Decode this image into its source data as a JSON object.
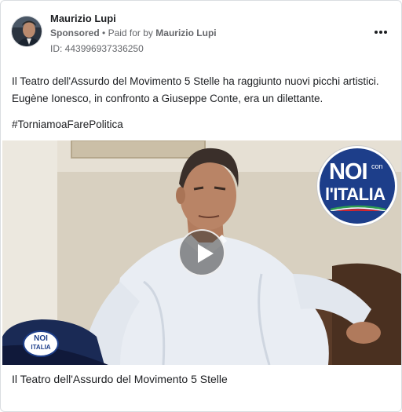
{
  "ad": {
    "advertiser_name": "Maurizio Lupi",
    "sponsored_label": "Sponsored",
    "separator": "•",
    "paid_for_label": "Paid for by",
    "paid_for_name": "Maurizio Lupi",
    "library_id": "ID: 443996937336250",
    "body_text": "Il Teatro dell'Assurdo del Movimento 5 Stelle ha raggiunto nuovi picchi artistici. Eugène Ionesco, in confronto a Giuseppe Conte, era un dilettante.",
    "hashtag": "#TorniamoaFarePolitica",
    "video_title": "Il Teatro dell'Assurdo del Movimento 5 Stelle"
  },
  "video_logo": {
    "line1": "NOI",
    "line1_small": "con",
    "line2": "l'ITALIA",
    "cap_text_top": "NOI",
    "cap_text_bottom": "ITALIA"
  },
  "icons": {
    "more": "more-options-icon",
    "play": "play-icon"
  },
  "colors": {
    "text_primary": "#1c1e21",
    "text_secondary": "#65676b",
    "border": "#dadde1",
    "logo_blue": "#1d3e8a"
  }
}
